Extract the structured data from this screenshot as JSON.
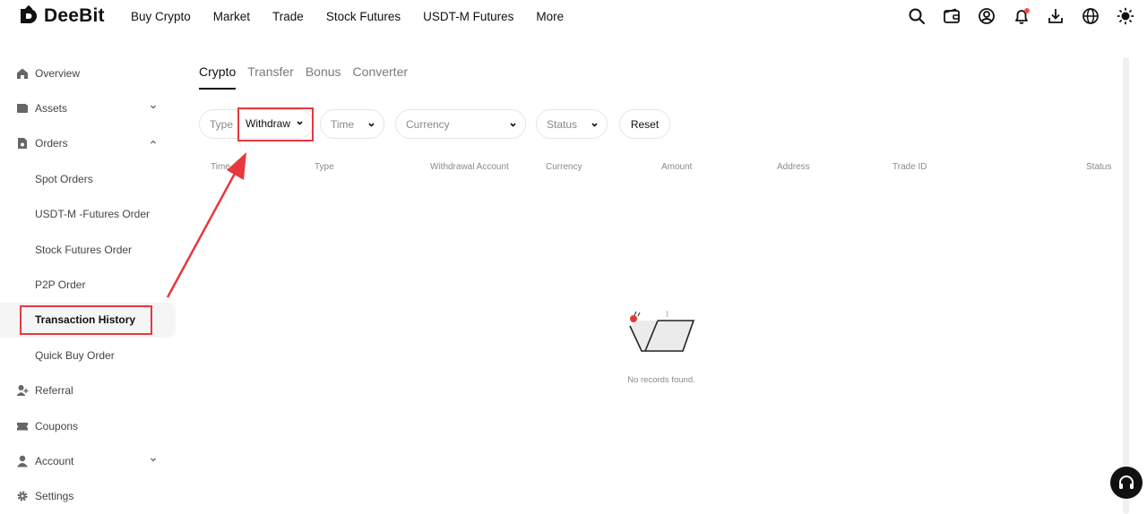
{
  "brand": {
    "name": "DeeBit"
  },
  "nav": [
    "Buy Crypto",
    "Market",
    "Trade",
    "Stock Futures",
    "USDT-M Futures",
    "More"
  ],
  "header_icons": [
    "search-icon",
    "wallet-icon",
    "user-icon",
    "bell-icon",
    "download-icon",
    "globe-icon",
    "theme-sun-icon"
  ],
  "sidebar": {
    "items": [
      {
        "label": "Overview",
        "icon": "home-icon"
      },
      {
        "label": "Assets",
        "icon": "wallet-icon",
        "expand": "chevron-down"
      },
      {
        "label": "Orders",
        "icon": "orders-icon",
        "expand": "chevron-up"
      },
      {
        "label": "Spot Orders"
      },
      {
        "label": "USDT-M -Futures Order"
      },
      {
        "label": "Stock Futures Order"
      },
      {
        "label": "P2P Order"
      },
      {
        "label": "Transaction History",
        "active": true
      },
      {
        "label": "Quick Buy Order"
      },
      {
        "label": "Referral",
        "icon": "referral-icon"
      },
      {
        "label": "Coupons",
        "icon": "coupon-icon"
      },
      {
        "label": "Account",
        "icon": "account-icon",
        "expand": "chevron-down"
      },
      {
        "label": "Settings",
        "icon": "settings-icon"
      }
    ]
  },
  "tabs": [
    "Crypto",
    "Transfer",
    "Bonus",
    "Converter"
  ],
  "active_tab": "Crypto",
  "filters": {
    "type_label": "Type",
    "type_value": "Withdraw",
    "time": "Time",
    "currency": "Currency",
    "status": "Status",
    "reset": "Reset"
  },
  "table": {
    "columns": [
      "Time",
      "Type",
      "Withdrawal Account",
      "Currency",
      "Amount",
      "Address",
      "Trade ID",
      "Status"
    ],
    "rows": []
  },
  "empty_state": {
    "text": "No records found."
  },
  "colors": {
    "highlight": "#e6393e",
    "notification_dot": "#f0514b",
    "active_bg": "#f5f5f5"
  }
}
